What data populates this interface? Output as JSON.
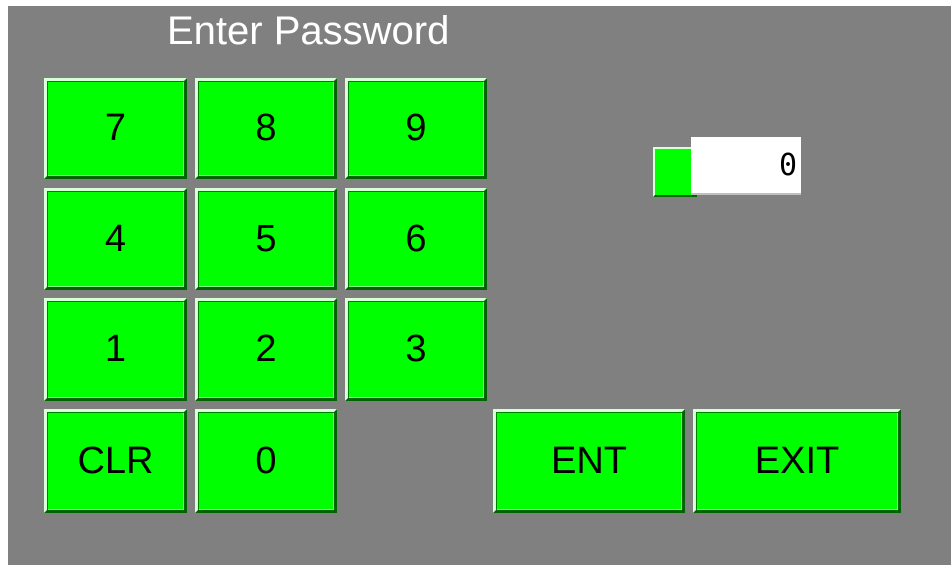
{
  "title": "Enter Password",
  "display": {
    "value": "0"
  },
  "keypad": {
    "k7": "7",
    "k8": "8",
    "k9": "9",
    "k4": "4",
    "k5": "5",
    "k6": "6",
    "k1": "1",
    "k2": "2",
    "k3": "3",
    "clr": "CLR",
    "k0": "0"
  },
  "actions": {
    "ent": "ENT",
    "exit": "EXIT"
  },
  "colors": {
    "background": "#808080",
    "key_face": "#00ff00",
    "title_text": "#ffffff",
    "display_background": "#ffffff"
  }
}
